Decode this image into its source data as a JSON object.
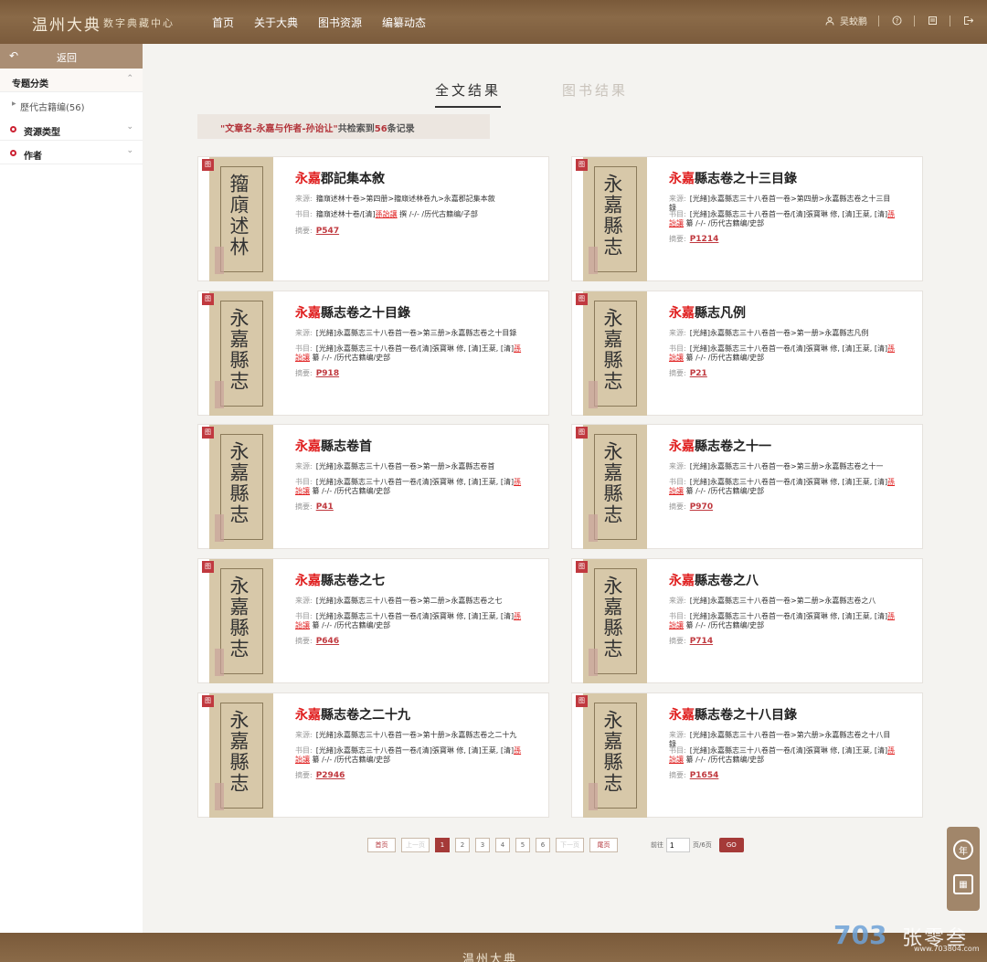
{
  "header": {
    "brand": "温州大典",
    "brand_sub": "数字典藏中心",
    "nav": [
      "首页",
      "关于大典",
      "图书资源",
      "编纂动态"
    ],
    "user": "吴蛟鹏"
  },
  "sidebar": {
    "back": "返回",
    "sections": {
      "topic": "专题分类",
      "topic_sub": "歷代古籍编(56)",
      "resource": "资源类型",
      "author": "作者"
    }
  },
  "tabs": {
    "fulltext": "全文结果",
    "books": "图书结果"
  },
  "banner": {
    "query": "\"文章名-永嘉与作者-孙诒让\"",
    "pre": "共检索到",
    "count": "56",
    "post": "条记录"
  },
  "labels": {
    "source": "来源:",
    "book": "书目:",
    "summary": "摘要:",
    "corner": "图"
  },
  "results": [
    {
      "title_hl": "永嘉",
      "title_rest": "郡記集本敘",
      "source": "籀廎述林十卷>第四册>籀廎述林卷九>永嘉郡記集本敘",
      "book_pre": "籀廎述林十卷/[清]",
      "book_hl": "孫詒讓",
      "book_post": " 撰 /-/- /历代古籍编/子部",
      "page": "P547",
      "cover": "籀廎述林"
    },
    {
      "title_hl": "永嘉",
      "title_rest": "縣志卷之十三目錄",
      "source": "[光緒]永嘉縣志三十八卷首一卷>第四册>永嘉縣志卷之十三目錄",
      "book_pre": "[光緒]永嘉縣志三十八卷首一卷/[清]張寶琳 修, [清]王棻, [清]",
      "book_hl": "孫詒讓",
      "book_post": " 纂 /-/- /历代古籍编/史部",
      "page": "P1214",
      "cover": "永嘉縣志"
    },
    {
      "title_hl": "永嘉",
      "title_rest": "縣志卷之十目錄",
      "source": "[光緒]永嘉縣志三十八卷首一卷>第三册>永嘉縣志卷之十目錄",
      "book_pre": "[光緒]永嘉縣志三十八卷首一卷/[清]張寶琳 修, [清]王棻, [清]",
      "book_hl": "孫詒讓",
      "book_post": " 纂 /-/- /历代古籍编/史部",
      "page": "P918",
      "cover": "永嘉縣志"
    },
    {
      "title_hl": "永嘉",
      "title_rest": "縣志凡例",
      "source": "[光緒]永嘉縣志三十八卷首一卷>第一册>永嘉縣志凡例",
      "book_pre": "[光緒]永嘉縣志三十八卷首一卷/[清]張寶琳 修, [清]王棻, [清]",
      "book_hl": "孫詒讓",
      "book_post": " 纂 /-/- /历代古籍编/史部",
      "page": "P21",
      "cover": "永嘉縣志"
    },
    {
      "title_hl": "永嘉",
      "title_rest": "縣志卷首",
      "source": "[光緒]永嘉縣志三十八卷首一卷>第一册>永嘉縣志卷首",
      "book_pre": "[光緒]永嘉縣志三十八卷首一卷/[清]張寶琳 修, [清]王棻, [清]",
      "book_hl": "孫詒讓",
      "book_post": " 纂 /-/- /历代古籍编/史部",
      "page": "P41",
      "cover": "永嘉縣志"
    },
    {
      "title_hl": "永嘉",
      "title_rest": "縣志卷之十一",
      "source": "[光緒]永嘉縣志三十八卷首一卷>第三册>永嘉縣志卷之十一",
      "book_pre": "[光緒]永嘉縣志三十八卷首一卷/[清]張寶琳 修, [清]王棻, [清]",
      "book_hl": "孫詒讓",
      "book_post": " 纂 /-/- /历代古籍编/史部",
      "page": "P970",
      "cover": "永嘉縣志"
    },
    {
      "title_hl": "永嘉",
      "title_rest": "縣志卷之七",
      "source": "[光緒]永嘉縣志三十八卷首一卷>第二册>永嘉縣志卷之七",
      "book_pre": "[光緒]永嘉縣志三十八卷首一卷/[清]張寶琳 修, [清]王棻, [清]",
      "book_hl": "孫詒讓",
      "book_post": " 纂 /-/- /历代古籍编/史部",
      "page": "P646",
      "cover": "永嘉縣志"
    },
    {
      "title_hl": "永嘉",
      "title_rest": "縣志卷之八",
      "source": "[光緒]永嘉縣志三十八卷首一卷>第二册>永嘉縣志卷之八",
      "book_pre": "[光緒]永嘉縣志三十八卷首一卷/[清]張寶琳 修, [清]王棻, [清]",
      "book_hl": "孫詒讓",
      "book_post": " 纂 /-/- /历代古籍编/史部",
      "page": "P714",
      "cover": "永嘉縣志"
    },
    {
      "title_hl": "永嘉",
      "title_rest": "縣志卷之二十九",
      "source": "[光緒]永嘉縣志三十八卷首一卷>第十册>永嘉縣志卷之二十九",
      "book_pre": "[光緒]永嘉縣志三十八卷首一卷/[清]張寶琳 修, [清]王棻, [清]",
      "book_hl": "孫詒讓",
      "book_post": " 纂 /-/- /历代古籍编/史部",
      "page": "P2946",
      "cover": "永嘉縣志"
    },
    {
      "title_hl": "永嘉",
      "title_rest": "縣志卷之十八目錄",
      "source": "[光緒]永嘉縣志三十八卷首一卷>第六册>永嘉縣志卷之十八目錄",
      "book_pre": "[光緒]永嘉縣志三十八卷首一卷/[清]張寶琳 修, [清]王棻, [清]",
      "book_hl": "孫詒讓",
      "book_post": " 纂 /-/- /历代古籍编/史部",
      "page": "P1654",
      "cover": "永嘉縣志"
    }
  ],
  "pager": {
    "first": "首页",
    "prev": "上一页",
    "pages": [
      "1",
      "2",
      "3",
      "4",
      "5",
      "6"
    ],
    "next": "下一页",
    "last": "尾页",
    "goto_pre": "前往",
    "goto_value": "1",
    "goto_post": "页/6页",
    "go": "GO"
  },
  "float": {
    "year_icon": "年",
    "book_icon": "▦"
  },
  "footer": {
    "text": "温州大典"
  },
  "watermark": {
    "logo": "703",
    "name": "张零叁",
    "url": "www.703804.com"
  }
}
